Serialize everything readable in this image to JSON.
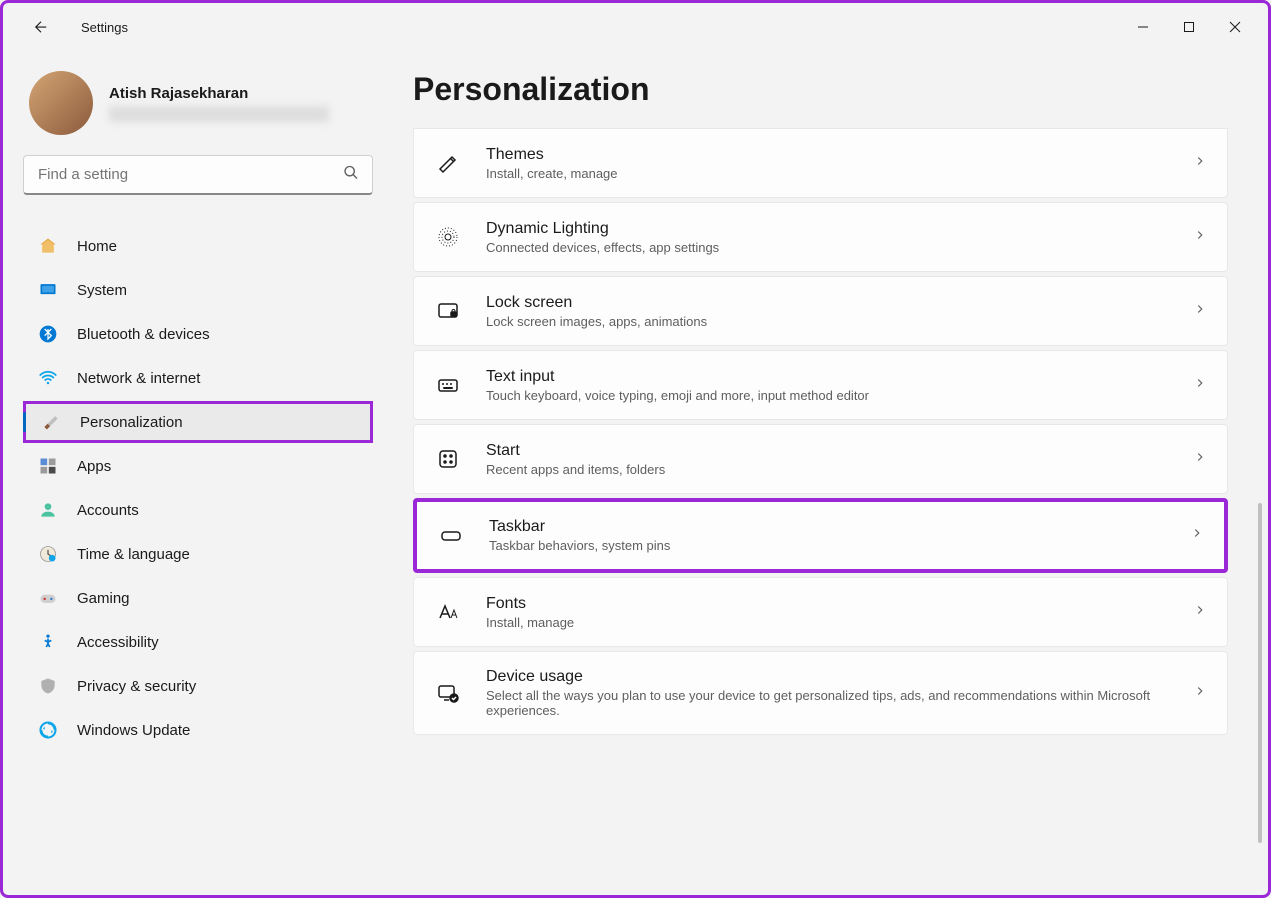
{
  "app": {
    "title": "Settings"
  },
  "user": {
    "name": "Atish Rajasekharan"
  },
  "search": {
    "placeholder": "Find a setting"
  },
  "nav": {
    "items": [
      {
        "label": "Home"
      },
      {
        "label": "System"
      },
      {
        "label": "Bluetooth & devices"
      },
      {
        "label": "Network & internet"
      },
      {
        "label": "Personalization"
      },
      {
        "label": "Apps"
      },
      {
        "label": "Accounts"
      },
      {
        "label": "Time & language"
      },
      {
        "label": "Gaming"
      },
      {
        "label": "Accessibility"
      },
      {
        "label": "Privacy & security"
      },
      {
        "label": "Windows Update"
      }
    ]
  },
  "page": {
    "title": "Personalization"
  },
  "settings": {
    "items": [
      {
        "title": "Themes",
        "desc": "Install, create, manage"
      },
      {
        "title": "Dynamic Lighting",
        "desc": "Connected devices, effects, app settings"
      },
      {
        "title": "Lock screen",
        "desc": "Lock screen images, apps, animations"
      },
      {
        "title": "Text input",
        "desc": "Touch keyboard, voice typing, emoji and more, input method editor"
      },
      {
        "title": "Start",
        "desc": "Recent apps and items, folders"
      },
      {
        "title": "Taskbar",
        "desc": "Taskbar behaviors, system pins"
      },
      {
        "title": "Fonts",
        "desc": "Install, manage"
      },
      {
        "title": "Device usage",
        "desc": "Select all the ways you plan to use your device to get personalized tips, ads, and recommendations within Microsoft experiences."
      }
    ]
  }
}
